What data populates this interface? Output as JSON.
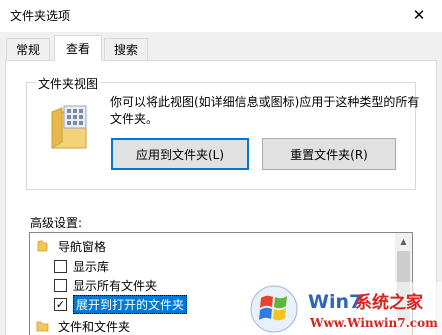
{
  "window": {
    "title": "文件夹选项",
    "close_symbol": "✕"
  },
  "tabs": [
    {
      "label": "常规"
    },
    {
      "label": "查看"
    },
    {
      "label": "搜索"
    }
  ],
  "folder_views": {
    "group_title": "文件夹视图",
    "description": "你可以将此视图(如详细信息或图标)应用于这种类型的所有文件夹。",
    "apply_button": "应用到文件夹(L)",
    "reset_button": "重置文件夹(R)"
  },
  "advanced": {
    "label": "高级设置:",
    "items": [
      {
        "label": "导航窗格",
        "type": "folder"
      },
      {
        "label": "显示库",
        "type": "checkbox",
        "checked": false
      },
      {
        "label": "显示所有文件夹",
        "type": "checkbox",
        "checked": false
      },
      {
        "label": "展开到打开的文件夹",
        "type": "checkbox",
        "checked": true,
        "selected": true
      },
      {
        "label": "文件和文件夹",
        "type": "folder"
      }
    ],
    "check_mark": "✓"
  },
  "watermark": {
    "brand_main": "Win7",
    "brand_suffix": "系统之家",
    "url": "Www.Winwin7.com"
  },
  "colors": {
    "selection": "#0078d7",
    "panel_bg": "#f0f0f0",
    "watermark_red": "#d6231b"
  }
}
